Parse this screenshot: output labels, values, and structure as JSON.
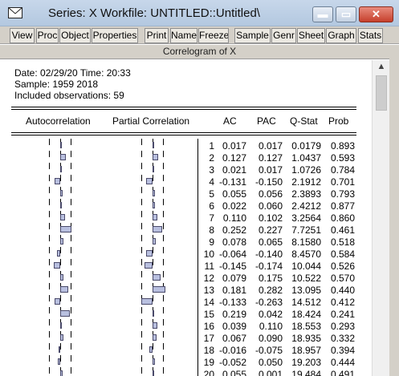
{
  "window": {
    "title": "Series: X   Workfile: UNTITLED::Untitled\\",
    "minimize_glyph": "▬",
    "maximize_glyph": "▭",
    "close_glyph": "✕"
  },
  "toolbar": {
    "buttons": [
      "View",
      "Proc",
      "Object",
      "Properties",
      "Print",
      "Name",
      "Freeze",
      "Sample",
      "Genr",
      "Sheet",
      "Graph",
      "Stats"
    ]
  },
  "view_title": "Correlogram of X",
  "info": {
    "date_line": "Date: 02/29/20   Time: 20:33",
    "sample_line": "Sample: 1959 2018",
    "obs_line": "Included observations: 59"
  },
  "columns": {
    "autocorrelation": "Autocorrelation",
    "partial": "Partial Correlation",
    "ac": "AC",
    "pac": "PAC",
    "qstat": "Q-Stat",
    "prob": "Prob"
  },
  "rows": [
    {
      "lag": "1",
      "ac": "0.017",
      "pac": "0.017",
      "q": "0.0179",
      "p": "0.893"
    },
    {
      "lag": "2",
      "ac": "0.127",
      "pac": "0.127",
      "q": "1.0437",
      "p": "0.593"
    },
    {
      "lag": "3",
      "ac": "0.021",
      "pac": "0.017",
      "q": "1.0726",
      "p": "0.784"
    },
    {
      "lag": "4",
      "ac": "-0.131",
      "pac": "-0.150",
      "q": "2.1912",
      "p": "0.701"
    },
    {
      "lag": "5",
      "ac": "0.055",
      "pac": "0.056",
      "q": "2.3893",
      "p": "0.793"
    },
    {
      "lag": "6",
      "ac": "0.022",
      "pac": "0.060",
      "q": "2.4212",
      "p": "0.877"
    },
    {
      "lag": "7",
      "ac": "0.110",
      "pac": "0.102",
      "q": "3.2564",
      "p": "0.860"
    },
    {
      "lag": "8",
      "ac": "0.252",
      "pac": "0.227",
      "q": "7.7251",
      "p": "0.461"
    },
    {
      "lag": "9",
      "ac": "0.078",
      "pac": "0.065",
      "q": "8.1580",
      "p": "0.518"
    },
    {
      "lag": "10",
      "ac": "-0.064",
      "pac": "-0.140",
      "q": "8.4570",
      "p": "0.584"
    },
    {
      "lag": "11",
      "ac": "-0.145",
      "pac": "-0.174",
      "q": "10.044",
      "p": "0.526"
    },
    {
      "lag": "12",
      "ac": "0.079",
      "pac": "0.175",
      "q": "10.522",
      "p": "0.570"
    },
    {
      "lag": "13",
      "ac": "0.181",
      "pac": "0.282",
      "q": "13.095",
      "p": "0.440"
    },
    {
      "lag": "14",
      "ac": "-0.133",
      "pac": "-0.263",
      "q": "14.512",
      "p": "0.412"
    },
    {
      "lag": "15",
      "ac": "0.219",
      "pac": "0.042",
      "q": "18.424",
      "p": "0.241"
    },
    {
      "lag": "16",
      "ac": "0.039",
      "pac": "0.110",
      "q": "18.553",
      "p": "0.293"
    },
    {
      "lag": "17",
      "ac": "0.067",
      "pac": "0.090",
      "q": "18.935",
      "p": "0.332"
    },
    {
      "lag": "18",
      "ac": "-0.016",
      "pac": "-0.075",
      "q": "18.957",
      "p": "0.394"
    },
    {
      "lag": "19",
      "ac": "-0.052",
      "pac": "0.050",
      "q": "19.203",
      "p": "0.444"
    },
    {
      "lag": "20",
      "ac": "0.055",
      "pac": "0.001",
      "q": "19.484",
      "p": "0.491"
    }
  ]
}
